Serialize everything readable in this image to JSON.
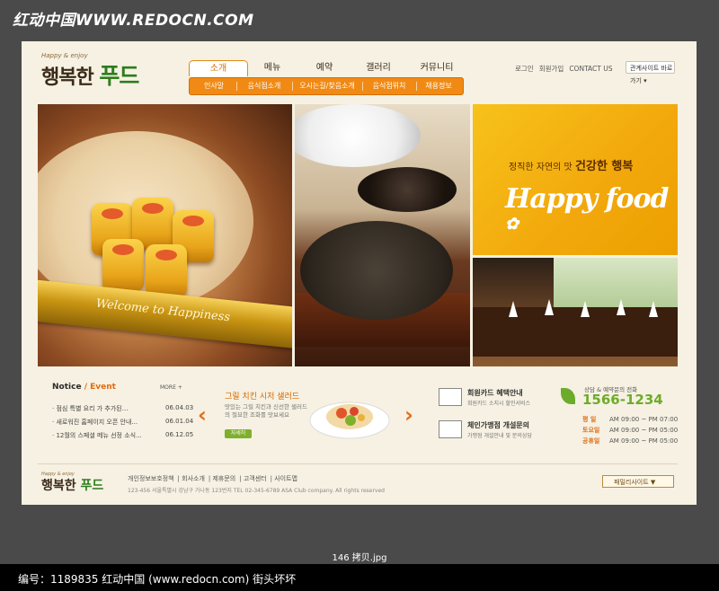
{
  "watermark": "红动中国WWW.REDOCN.COM",
  "header": {
    "logo_tagline": "Happy & enjoy",
    "logo_text": "행복한",
    "logo_accent": "푸드",
    "main_nav": [
      "소개",
      "메뉴",
      "예약",
      "갤러리",
      "커뮤니티"
    ],
    "active_tab": "소개",
    "sub_nav": [
      "인사말",
      "음식점소개",
      "오시는길/찾음소개",
      "음식점위치",
      "채용정보"
    ],
    "top_links": [
      "로그인",
      "회원가입",
      "CONTACT US"
    ],
    "family_select": "관계사이트 바로가기"
  },
  "hero": {
    "ribbon_text": "Welcome to Happiness",
    "tagline_prefix": "정직한 자연의 맛",
    "tagline_bold": "건강한 행복",
    "brand_logo": "Happy food"
  },
  "notice": {
    "title": "Notice",
    "title_accent": "/ Event",
    "more": "MORE +",
    "items": [
      {
        "text": "· 점심 특별 요리 가 추가된...",
        "date": "06.04.03"
      },
      {
        "text": "· 새로워진 홈페이지 오픈 안내...",
        "date": "06.01.04"
      },
      {
        "text": "· 12월의 스페셜 메뉴 선정 소식...",
        "date": "06.12.05"
      }
    ]
  },
  "promo": {
    "title": "그릴 치킨 시저 샐러드",
    "desc_line1": "맛있는 그릴 치킨과 신선한 샐러드",
    "desc_line2": "의 절묘한 조화를 맛보세요",
    "button": "자세히"
  },
  "services": [
    {
      "title": "회원카드 혜택안내",
      "sub": "회원카드 소지시 할인서비스"
    },
    {
      "title": "체인가맹점 개설문의",
      "sub": "가맹점 개설안내 및 문의상담"
    }
  ],
  "hours": {
    "title": "상담 & 예약문의 전화",
    "phone": "1566-1234",
    "rows": [
      {
        "label": "평 일",
        "time": "AM 09:00 ~ PM 07:00"
      },
      {
        "label": "토요일",
        "time": "AM 09:00 ~ PM 05:00"
      },
      {
        "label": "공휴일",
        "time": "AM 09:00 ~ PM 05:00"
      }
    ]
  },
  "footer": {
    "logo_tagline": "Happy & enjoy",
    "logo_text": "행복한",
    "logo_accent": "푸드",
    "links": [
      "개인정보보호정책",
      "회사소개",
      "제휴문의",
      "고객센터",
      "사이트맵"
    ],
    "copyright": "123-456 서울특별시 강남구 가나동 123번지 TEL 02-345-6789 ASA Club company. All rights reserved",
    "family_site": "패밀리사이트 ▼"
  },
  "image_filename": "146 拷贝.jpg",
  "caption": "编号：1189835    红动中国 (www.redocn.com)    街头坏坏",
  "colors": {
    "accent_orange": "#f08a14",
    "accent_green": "#6dac2a",
    "banner_yellow": "#f2a80c"
  }
}
